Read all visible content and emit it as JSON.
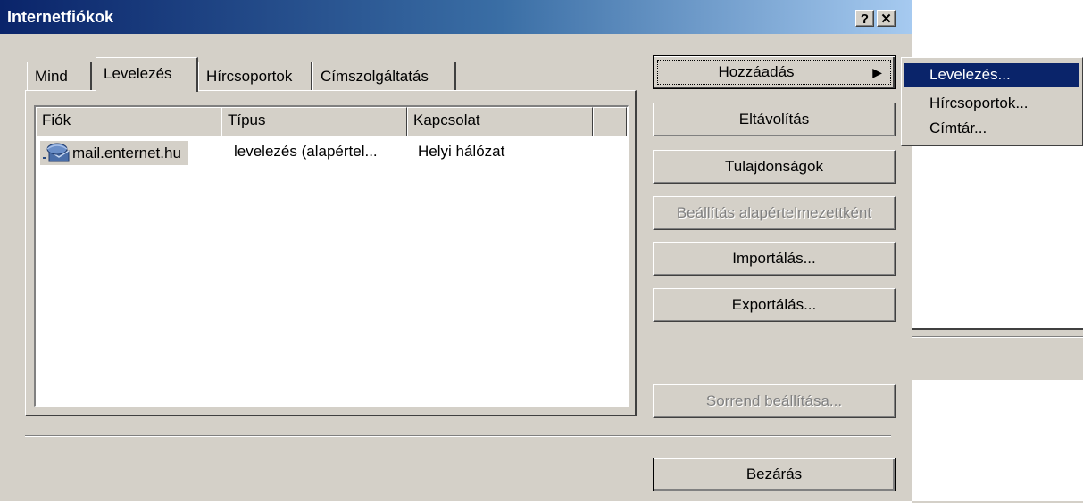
{
  "window": {
    "title": "Internetfiókok",
    "help_label": "?",
    "close_label": "✕"
  },
  "tabs": [
    {
      "label": "Mind"
    },
    {
      "label": "Levelezés"
    },
    {
      "label": "Hírcsoportok"
    },
    {
      "label": "Címszolgáltatás"
    }
  ],
  "table": {
    "columns": [
      "Fiók",
      "Típus",
      "Kapcsolat"
    ],
    "rows": [
      {
        "account": "mail.enternet.hu",
        "type": "levelezés (alapértel...",
        "connection": "Helyi hálózat",
        "icon": "mail-account-icon"
      }
    ]
  },
  "buttons": {
    "add": "Hozzáadás",
    "remove": "Eltávolítás",
    "properties": "Tulajdonságok",
    "set_default": "Beállítás alapértelmezettként",
    "import": "Importálás...",
    "export": "Exportálás...",
    "order": "Sorrend beállítása...",
    "close": "Bezárás"
  },
  "add_menu": {
    "items": [
      "Levelezés...",
      "Hírcsoportok...",
      "Címtár..."
    ],
    "highlighted": "Levelezés..."
  },
  "colors": {
    "title_gradient_start": "#0a246a",
    "title_gradient_end": "#a6caf0",
    "face": "#d4d0c8",
    "highlight": "#0a246a"
  }
}
